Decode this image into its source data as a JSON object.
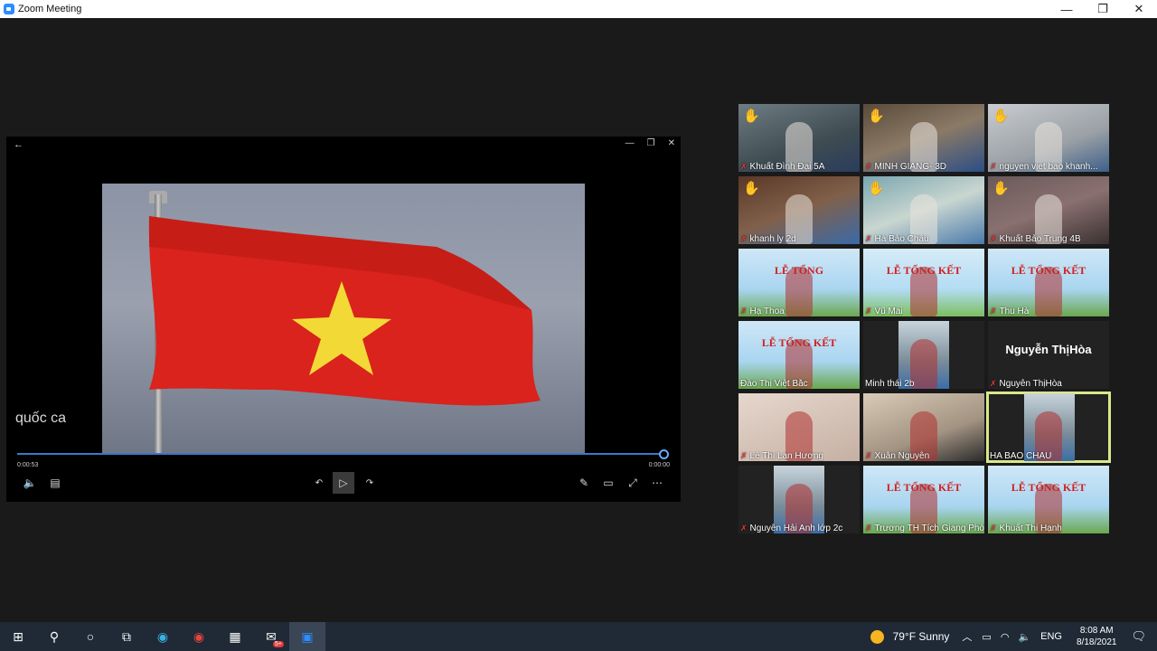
{
  "window": {
    "title": "Zoom Meeting",
    "controls": [
      "—",
      "❐",
      "✕"
    ]
  },
  "player": {
    "caption": "quốc ca",
    "time_elapsed": "0:00:53",
    "time_remaining": "0:00:00",
    "progress": 0.99
  },
  "participants": [
    {
      "name": "Khuất Đình Đại 5A",
      "muted": true,
      "hand_raised": true
    },
    {
      "name": "MINH GIANG- 3D",
      "muted": true,
      "hand_raised": true
    },
    {
      "name": "nguyen viet bao khanh...",
      "muted": true,
      "hand_raised": true
    },
    {
      "name": "khanh ly 2d",
      "muted": true,
      "hand_raised": true
    },
    {
      "name": "Hà Bảo Châu",
      "muted": true,
      "hand_raised": true
    },
    {
      "name": "Khuất Bảo Trung 4B",
      "muted": true,
      "hand_raised": true
    },
    {
      "name": "Hạ Thoa",
      "muted": true,
      "hand_raised": false
    },
    {
      "name": "Vũ Mai",
      "muted": true,
      "hand_raised": false
    },
    {
      "name": "Thu Hà",
      "muted": true,
      "hand_raised": false
    },
    {
      "name": "Đào Thị Việt Bắc",
      "muted": false,
      "hand_raised": false
    },
    {
      "name": "Minh thái 2b",
      "muted": false,
      "hand_raised": false
    },
    {
      "name": "Nguyễn ThịHòa",
      "muted": true,
      "hand_raised": false,
      "display_name": "Nguyễn ThịHòa"
    },
    {
      "name": "Lê Thị Lan Hương",
      "muted": true,
      "hand_raised": false
    },
    {
      "name": "Xuân Nguyễn",
      "muted": true,
      "hand_raised": false
    },
    {
      "name": "HA BAO CHAU",
      "muted": false,
      "hand_raised": false,
      "active_speaker": true
    },
    {
      "name": "Nguyễn Hải Anh lớp 2c",
      "muted": true,
      "hand_raised": false
    },
    {
      "name": "Trương TH Tích Giang Phò...",
      "muted": true,
      "hand_raised": false
    },
    {
      "name": "Khuất Thị Hạnh",
      "muted": true,
      "hand_raised": false
    }
  ],
  "banner_text": {
    "title_1": "LỄ TỔNG",
    "title_2": "LỄ TỔNG KẾT",
    "title_3": "LỄ TỔNG KẾT"
  },
  "taskbar": {
    "weather": "79°F  Sunny",
    "language": "ENG",
    "time": "8:08 AM",
    "date": "8/18/2021",
    "notification_badge": "5+"
  },
  "colors": {
    "flag_red": "#d9231c",
    "flag_star": "#f2d936",
    "active_border": "#d9e88a",
    "mute_red": "#e23a3a",
    "hand_yellow": "#f4c622"
  }
}
